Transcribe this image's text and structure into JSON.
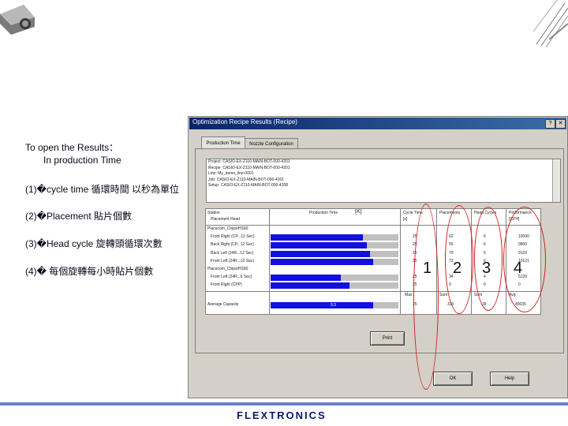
{
  "slide": {
    "notes": {
      "heading": "To open the Results：",
      "subheading": "In production Time",
      "item1": "(1)�cycle time 循環時間 以秒為單位",
      "item2": "(2)�Placement 貼片個數",
      "item3": "(3)�Head cycle 旋轉頭循環次數",
      "item4": "(4)� 每個旋轉每小時貼片個數"
    },
    "logo": "FLEXTRONICS"
  },
  "dialog": {
    "title": "Optimization Recipe Results (Recipe)",
    "help_btn": "?",
    "close_btn": "✕",
    "tabs": [
      "Production Time",
      "Nozzle Configuration"
    ],
    "info_lines": [
      "Project: CASIO-EX-Z110-MAIN-BOT-000-4201",
      "Recipe: CASIO-EX-Z110-MAIN-BOT-000-4201",
      "Line: My_demo_line-0001",
      "Job: CASIO-EX-Z110-MAIN-BOT-000-4201",
      "Setup: CASIO-EX-Z110-MAIN-BOT-000-4208"
    ],
    "table": {
      "headers": {
        "station": "Station",
        "placement_head": "Placement Head",
        "production_time": "Production Time",
        "marker": "[K]",
        "cycle_time": "Cycle Time",
        "cycle_time_unit": "[s]",
        "placements": "Placements",
        "head_cycles": "Head Cycles",
        "performance": "Performance",
        "performance_unit": "[CPH]"
      },
      "rows": [
        {
          "label": "Placecom_Chips/HS60",
          "indent": false,
          "fill": null,
          "cycle": "",
          "place": "",
          "head": "",
          "perf": ""
        },
        {
          "label": "Front Right (CP...12 Sec)",
          "indent": true,
          "fill": 0.72,
          "cycle": "25",
          "place": "62",
          "head": "6",
          "perf": "10000"
        },
        {
          "label": "Back Right (CP...12 Sec)",
          "indent": true,
          "fill": 0.75,
          "cycle": "25",
          "place": "55",
          "head": "6",
          "perf": "9800"
        },
        {
          "label": "Back Left (24R...12 Sec)",
          "indent": true,
          "fill": 0.78,
          "cycle": "25",
          "place": "70",
          "head": "6",
          "perf": "9120"
        },
        {
          "label": "Front Left (24R...12 Sec)",
          "indent": true,
          "fill": 0.8,
          "cycle": "25",
          "place": "72",
          "head": "6",
          "perf": "10121"
        },
        {
          "label": "Placecom_Chips/HS60",
          "indent": false,
          "fill": null,
          "cycle": "",
          "place": "",
          "head": "",
          "perf": ""
        },
        {
          "label": "Front Left (24R...6 Sec)",
          "indent": true,
          "fill": 0.55,
          "cycle": "25",
          "place": "34",
          "head": "4",
          "perf": "5120"
        },
        {
          "label": "Front Right (CPP)",
          "indent": true,
          "fill": 0.62,
          "cycle": "25",
          "place": "0",
          "head": "0",
          "perf": "0"
        }
      ],
      "summary_row": {
        "cycle": "Max",
        "place": "Sum",
        "head": "Sum",
        "perf": "Avg"
      },
      "total_row": {
        "label": "Average Capacity",
        "fill": 0.8,
        "bar_text": "9.3",
        "cycle": "25",
        "place": "330",
        "head": "39",
        "perf": "49035"
      }
    },
    "print_btn": "Print",
    "ok_btn": "OK",
    "help_button": "Help"
  },
  "annotations": {
    "labels": [
      "1",
      "2",
      "3",
      "4"
    ]
  },
  "colors": {
    "accent": "#1010e0",
    "annotation_red": "#d02020",
    "footer_line": "#6b7ec9",
    "logo": "#0a1a6a"
  }
}
